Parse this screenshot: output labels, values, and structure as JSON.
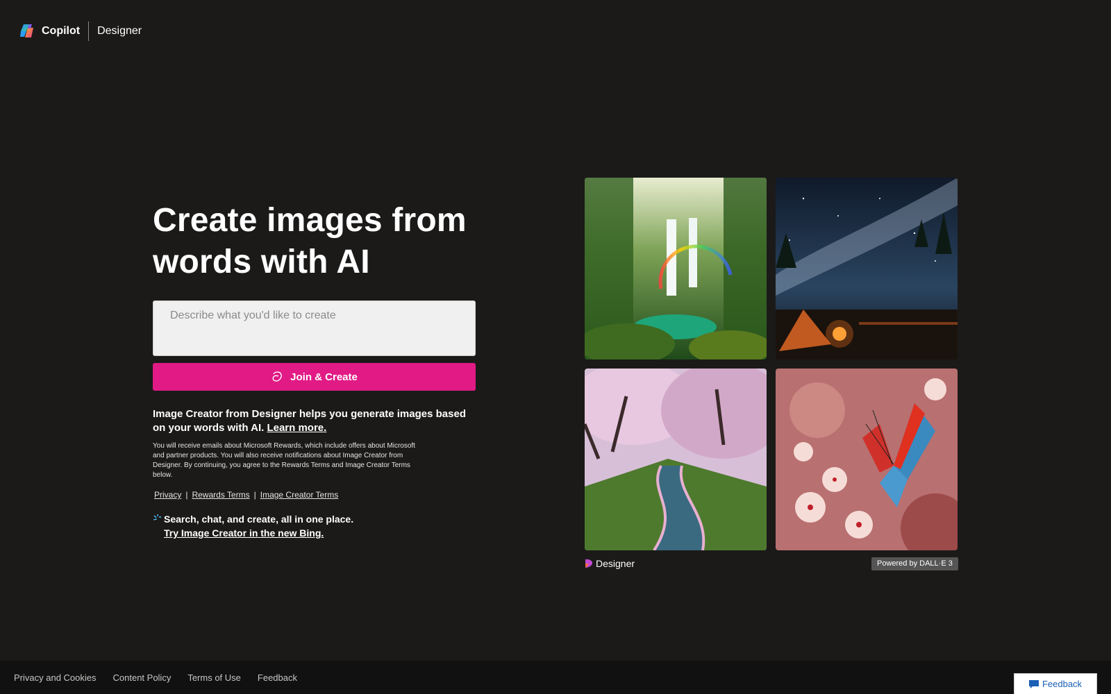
{
  "header": {
    "brand": "Copilot",
    "product": "Designer",
    "logo_icon": "copilot-logo-icon"
  },
  "hero": {
    "title": "Create images from words with AI"
  },
  "prompt": {
    "placeholder": "Describe what you'd like to create",
    "value": ""
  },
  "join_button": {
    "label": "Join & Create",
    "icon": "create-icon",
    "color": "#e11a85"
  },
  "description": {
    "text": "Image Creator from Designer helps you generate images based on your words with AI.",
    "link": "Learn more."
  },
  "fine_print": "You will receive emails about Microsoft Rewards, which include offers about Microsoft and partner products. You will also receive notifications about Image Creator from Designer. By continuing, you agree to the Rewards Terms and Image Creator Terms below.",
  "links": {
    "privacy": "Privacy",
    "separator": "|",
    "rewards_terms": "Rewards Terms",
    "image_creator_terms": "Image Creator Terms"
  },
  "bing_promo": {
    "text": "Search, chat, and create, all in one place.",
    "link": "Try Image Creator in the new Bing.",
    "icon": "bing-sparkle-icon"
  },
  "gallery": {
    "tiles": [
      {
        "name": "waterfall-rainbow-image"
      },
      {
        "name": "starry-camp-image"
      },
      {
        "name": "cherry-blossom-river-image"
      },
      {
        "name": "butterfly-blossom-image"
      }
    ],
    "designer_label": "Designer",
    "powered_by": "Powered by DALL·E 3"
  },
  "footer": {
    "privacy_cookies": "Privacy and Cookies",
    "content_policy": "Content Policy",
    "terms_of_use": "Terms of Use",
    "feedback": "Feedback"
  },
  "feedback_button": {
    "label": "Feedback",
    "icon": "feedback-icon"
  }
}
